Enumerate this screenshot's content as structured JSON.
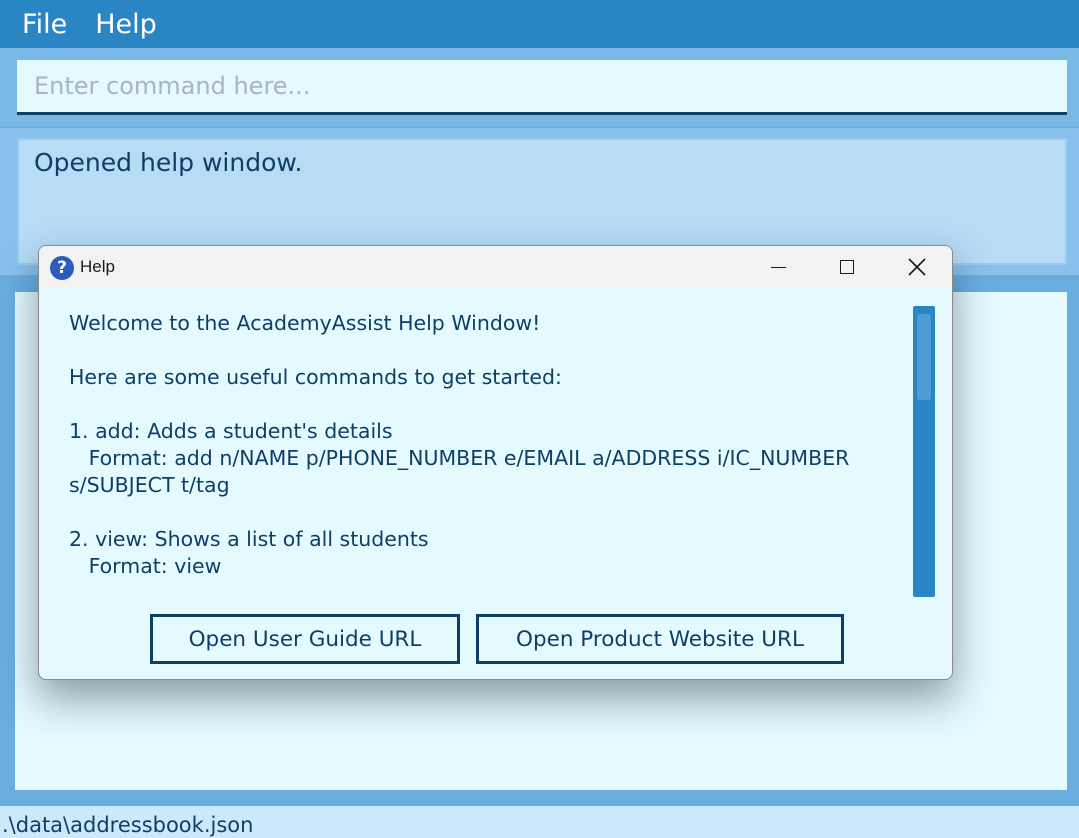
{
  "menu": {
    "items": [
      {
        "label": "File"
      },
      {
        "label": "Help"
      }
    ]
  },
  "command": {
    "placeholder": "Enter command here...",
    "value": ""
  },
  "result": {
    "text": "Opened help window."
  },
  "status": {
    "path": ".\\data\\addressbook.json"
  },
  "help_window": {
    "title": "Help",
    "icon": "question-icon",
    "text": "Welcome to the AcademyAssist Help Window!\n\nHere are some useful commands to get started:\n\n1. add: Adds a student's details\n   Format: add n/NAME p/PHONE_NUMBER e/EMAIL a/ADDRESS i/IC_NUMBER s/SUBJECT t/tag\n\n2. view: Shows a list of all students\n   Format: view",
    "buttons": {
      "user_guide": "Open User Guide URL",
      "product_website": "Open Product Website URL"
    }
  },
  "colors": {
    "accent": "#2a85c4",
    "panel": "#e4fafe",
    "text": "#0e3f66"
  }
}
